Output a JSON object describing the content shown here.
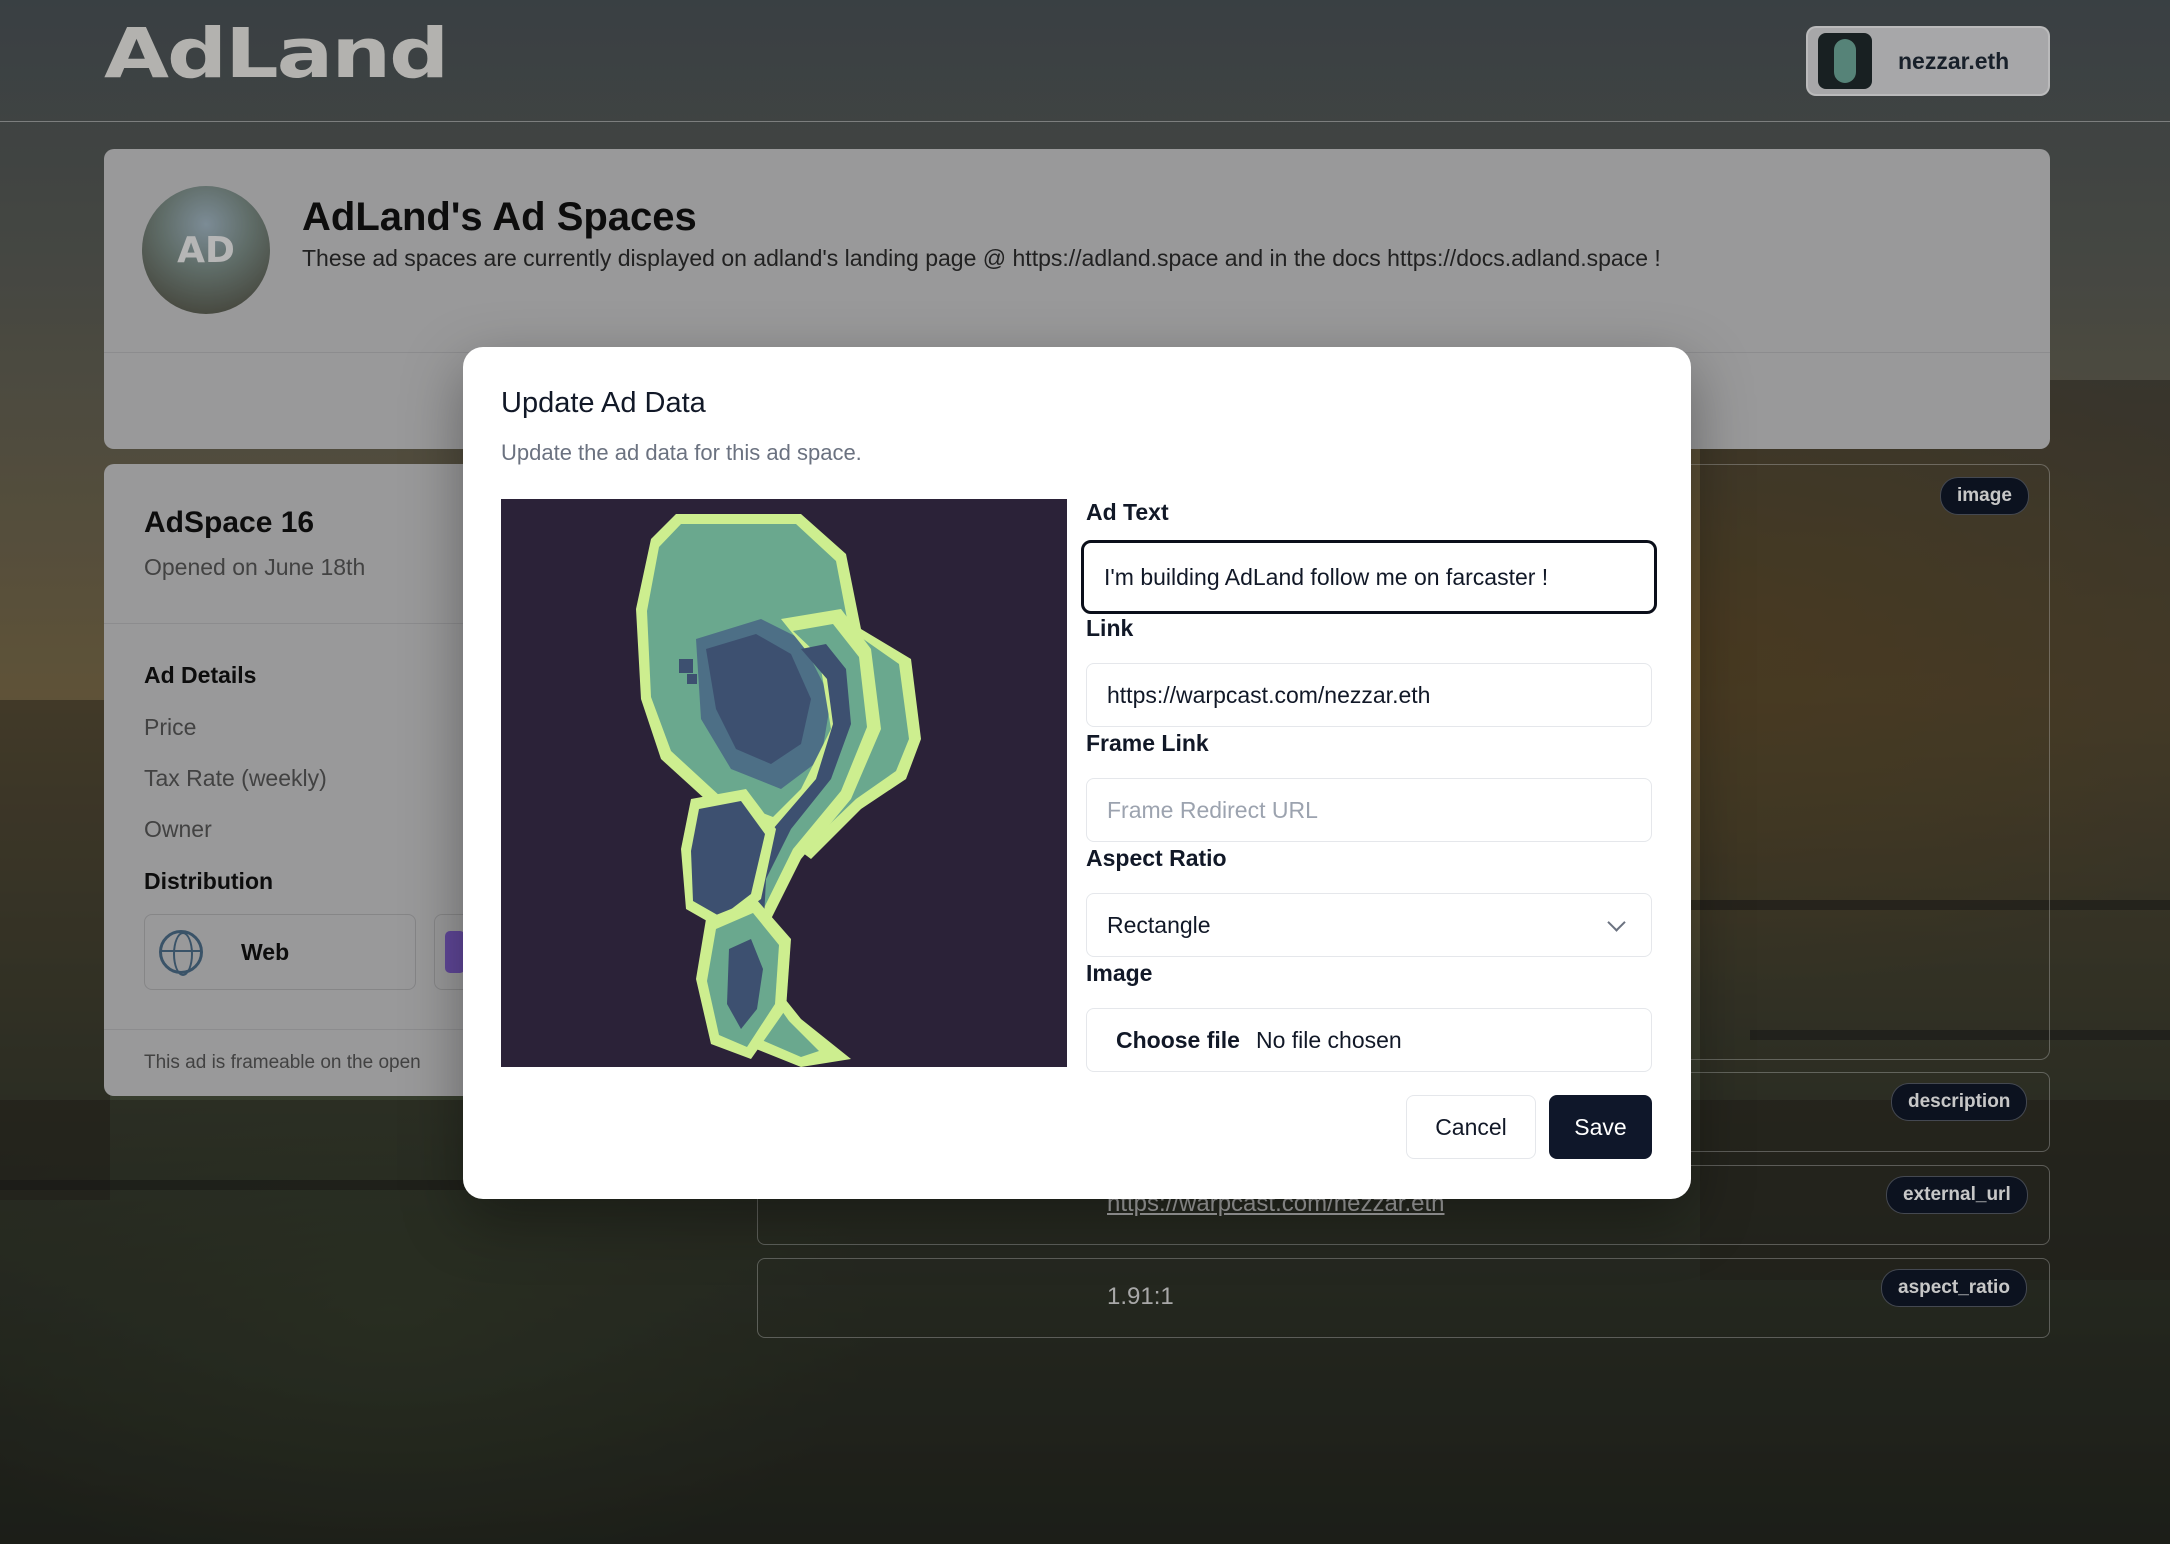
{
  "header": {
    "logo_text": "AdLand",
    "user_name": "nezzar.eth"
  },
  "banner": {
    "logo_text": "AD",
    "title": "AdLand's Ad Spaces",
    "description": "These ad spaces are currently displayed on adland's landing page @ https://adland.space and in the docs https://docs.adland.space !"
  },
  "adspace": {
    "title": "AdSpace 16",
    "opened": "Opened on June 18th",
    "ad_details_heading": "Ad Details",
    "rows": [
      "Price",
      "Tax Rate (weekly)",
      "Owner"
    ],
    "distribution_heading": "Distribution",
    "distribution_web": "Web",
    "footer": "This ad is frameable on the open"
  },
  "fields": {
    "image_tag": "image",
    "description_tag": "description",
    "external_url_tag": "external_url",
    "external_url_value": "https://warpcast.com/nezzar.eth",
    "aspect_ratio_tag": "aspect_ratio",
    "aspect_ratio_value": "1.91:1"
  },
  "modal": {
    "title": "Update Ad Data",
    "subtitle": "Update the ad data for this ad space.",
    "ad_text_label": "Ad Text",
    "ad_text_value": "I'm building AdLand follow me on farcaster !",
    "link_label": "Link",
    "link_value": "https://warpcast.com/nezzar.eth",
    "frame_link_label": "Frame Link",
    "frame_link_placeholder": "Frame Redirect URL",
    "aspect_ratio_label": "Aspect Ratio",
    "aspect_ratio_value": "Rectangle",
    "image_label": "Image",
    "choose_file": "Choose file",
    "no_file": "No file chosen",
    "cancel": "Cancel",
    "save": "Save"
  },
  "colors": {
    "accent": "#0f172a",
    "pill_bg": "#101828",
    "card_bg": "#c4c4c6"
  }
}
